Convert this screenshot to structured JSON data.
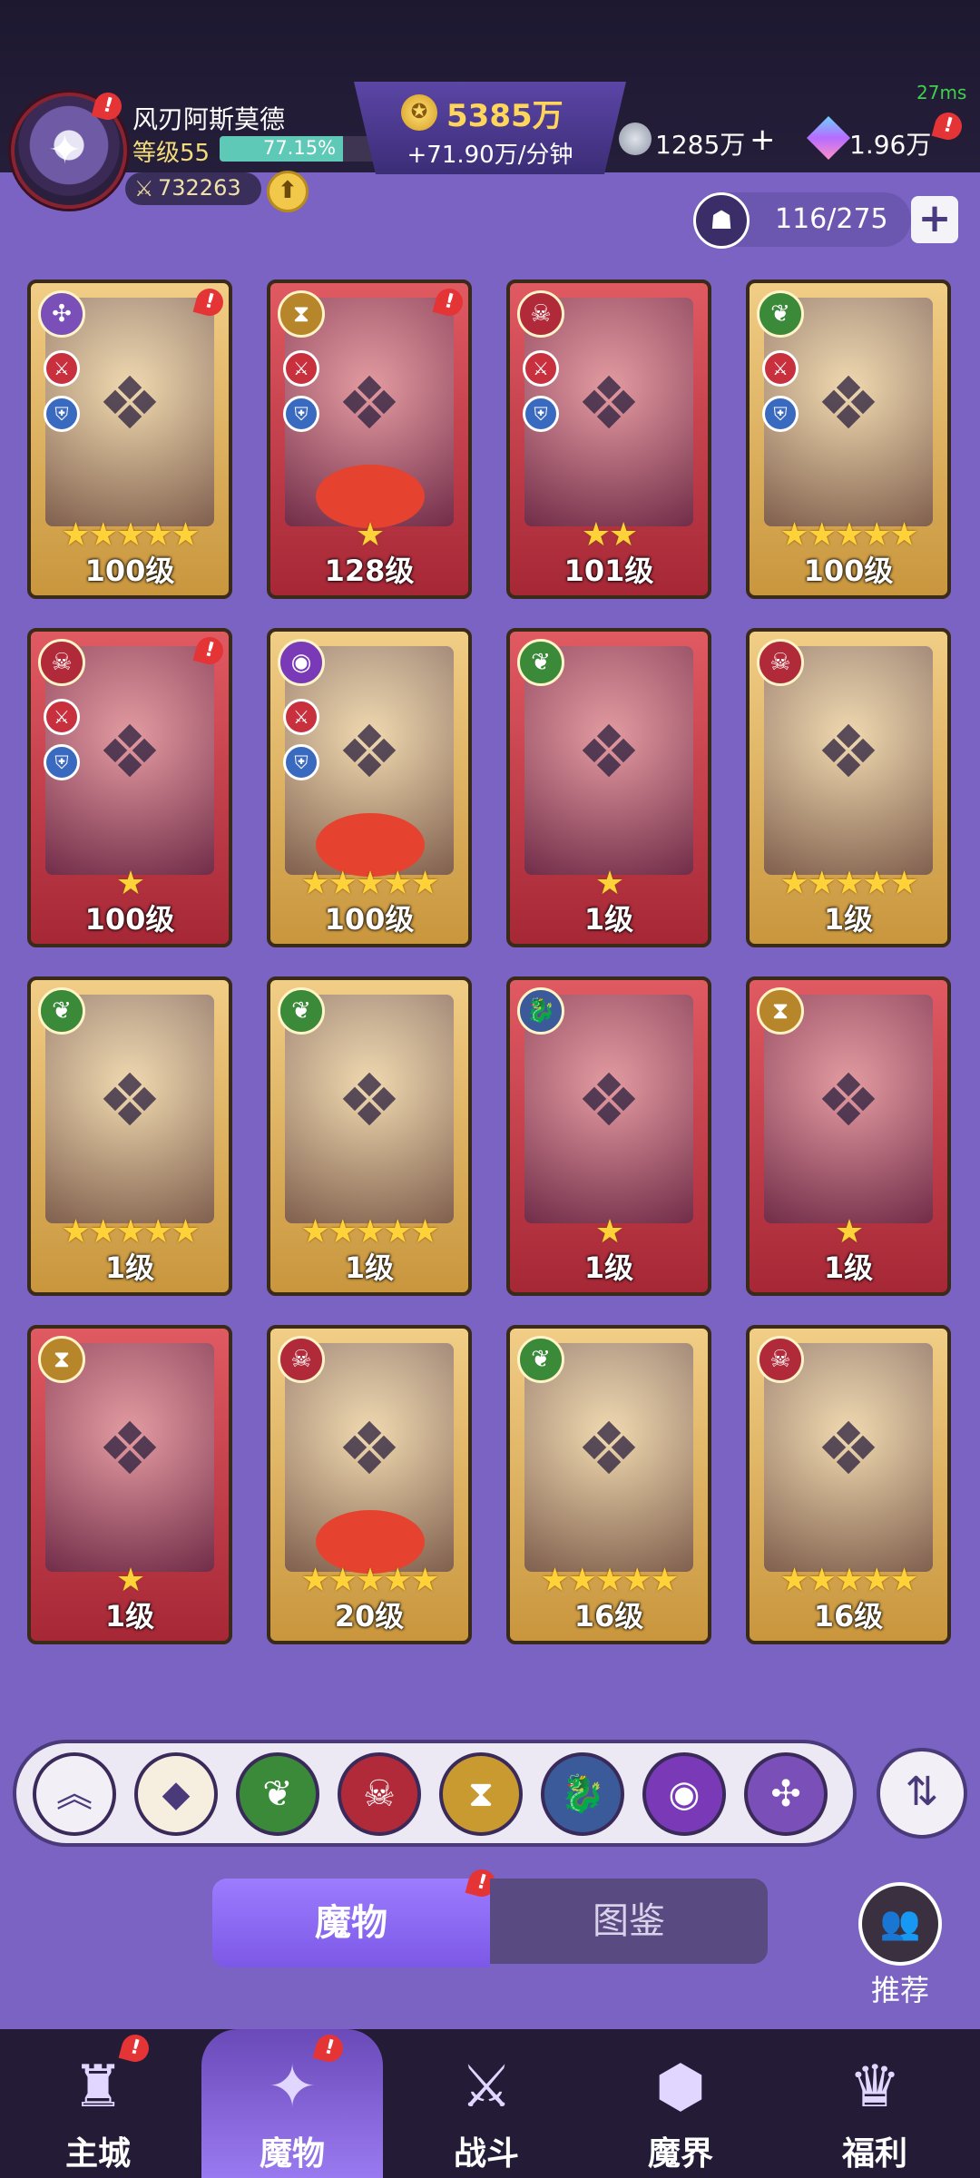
{
  "player": {
    "name": "风刃阿斯莫德",
    "level_label": "等级55",
    "exp_text": "77.15%",
    "exp_fraction": 0.7715,
    "power": "732263"
  },
  "resources": {
    "gold": "5385万",
    "gold_rate": "+71.90万/分钟",
    "gems": "1285万",
    "gem_plus": "+",
    "crystals": "1.96万",
    "latency": "27ms"
  },
  "capacity": {
    "text": "116/275",
    "add": "+"
  },
  "cards": [
    {
      "level": "100级",
      "stars": 5,
      "star_glyph": "★★★★★",
      "bg": "gold",
      "faction": "vortex-icon",
      "faction_color": "#7a4fb8",
      "roles": true,
      "badge": true
    },
    {
      "level": "128级",
      "stars": 1,
      "star_glyph": "★",
      "bg": "red",
      "faction": "hourglass-icon",
      "faction_color": "#b8862a",
      "roles": true,
      "badge": true,
      "redacted": true
    },
    {
      "level": "101级",
      "stars": 2,
      "star_glyph": "★★",
      "bg": "red",
      "faction": "demon-icon",
      "faction_color": "#b02a3a",
      "roles": true,
      "badge": false
    },
    {
      "level": "100级",
      "stars": 5,
      "star_glyph": "★★★★★",
      "bg": "gold",
      "faction": "leaf-icon",
      "faction_color": "#3a8a3a",
      "roles": true,
      "badge": false
    },
    {
      "level": "100级",
      "stars": 1,
      "star_glyph": "★",
      "bg": "red",
      "faction": "demon-icon",
      "faction_color": "#b02a3a",
      "roles": true,
      "badge": true
    },
    {
      "level": "100级",
      "stars": 5,
      "star_glyph": "★★★★★",
      "bg": "gold",
      "faction": "eye-icon",
      "faction_color": "#7a3ab8",
      "roles": true,
      "badge": false,
      "redacted": true
    },
    {
      "level": "1级",
      "stars": 1,
      "star_glyph": "★",
      "bg": "red",
      "faction": "leaf-icon",
      "faction_color": "#3a8a3a",
      "roles": false,
      "badge": false
    },
    {
      "level": "1级",
      "stars": 5,
      "star_glyph": "★★★★★",
      "bg": "gold",
      "faction": "demon-icon",
      "faction_color": "#b02a3a",
      "roles": false,
      "badge": false
    },
    {
      "level": "1级",
      "stars": 5,
      "star_glyph": "★★★★★",
      "bg": "gold",
      "faction": "leaf-icon",
      "faction_color": "#3a8a3a",
      "roles": false,
      "badge": false
    },
    {
      "level": "1级",
      "stars": 5,
      "star_glyph": "★★★★★",
      "bg": "gold",
      "faction": "leaf-icon",
      "faction_color": "#3a8a3a",
      "roles": false,
      "badge": false
    },
    {
      "level": "1级",
      "stars": 1,
      "star_glyph": "★",
      "bg": "red",
      "faction": "dragon-icon",
      "faction_color": "#3a5a9a",
      "roles": false,
      "badge": false
    },
    {
      "level": "1级",
      "stars": 1,
      "star_glyph": "★",
      "bg": "red",
      "faction": "hourglass-icon",
      "faction_color": "#b8862a",
      "roles": false,
      "badge": false
    },
    {
      "level": "1级",
      "stars": 1,
      "star_glyph": "★",
      "bg": "red",
      "faction": "hourglass-icon",
      "faction_color": "#b8862a",
      "roles": false,
      "badge": false
    },
    {
      "level": "20级",
      "stars": 5,
      "star_glyph": "★★★★★",
      "bg": "gold",
      "faction": "demon-icon",
      "faction_color": "#b02a3a",
      "roles": false,
      "badge": false,
      "redacted": true
    },
    {
      "level": "16级",
      "stars": 5,
      "star_glyph": "★★★★★",
      "bg": "gold",
      "faction": "leaf-icon",
      "faction_color": "#3a8a3a",
      "roles": false,
      "badge": false
    },
    {
      "level": "16级",
      "stars": 5,
      "star_glyph": "★★★★★",
      "bg": "gold",
      "faction": "demon-icon",
      "faction_color": "#b02a3a",
      "roles": false,
      "badge": false
    }
  ],
  "filters": [
    {
      "name": "collapse-icon",
      "glyph": "︽",
      "color": "#f2eff7",
      "fg": "#4a3a7a"
    },
    {
      "name": "all-factions-icon",
      "glyph": "◆",
      "color": "#f6efe0",
      "fg": "#4a3a7a"
    },
    {
      "name": "leaf-icon",
      "glyph": "❦",
      "color": "#3a8a3a",
      "fg": "#ffffff"
    },
    {
      "name": "demon-icon",
      "glyph": "☠",
      "color": "#b02a3a",
      "fg": "#ffffff"
    },
    {
      "name": "hourglass-icon",
      "glyph": "⧗",
      "color": "#c89a30",
      "fg": "#ffffff"
    },
    {
      "name": "dragon-icon",
      "glyph": "🐉",
      "color": "#3a5a9a",
      "fg": "#ffffff"
    },
    {
      "name": "eye-icon",
      "glyph": "◉",
      "color": "#7a3ab8",
      "fg": "#ffffff"
    },
    {
      "name": "vortex-icon",
      "glyph": "✣",
      "color": "#7a4fb8",
      "fg": "#ffffff"
    }
  ],
  "tabs": {
    "monsters": "魔物",
    "codex": "图鉴"
  },
  "recommend": {
    "label": "推荐"
  },
  "nav": [
    {
      "label": "主城",
      "icon": "castle-icon",
      "glyph": "♜",
      "badge": true
    },
    {
      "label": "魔物",
      "icon": "monster-flame-icon",
      "glyph": "✦",
      "badge": true,
      "active": true
    },
    {
      "label": "战斗",
      "icon": "battle-shield-icon",
      "glyph": "⚔",
      "badge": false
    },
    {
      "label": "魔界",
      "icon": "demon-realm-icon",
      "glyph": "⬢",
      "badge": false
    },
    {
      "label": "福利",
      "icon": "welfare-chest-icon",
      "glyph": "♛",
      "badge": false
    }
  ]
}
